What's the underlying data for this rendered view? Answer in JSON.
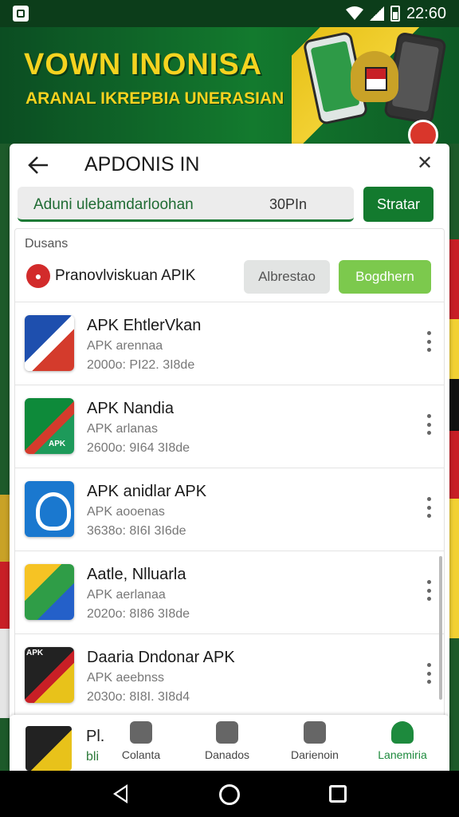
{
  "status_bar": {
    "time": "22:60"
  },
  "banner": {
    "title": "VOWN INONISA",
    "subtitle": "ARANAL IKREPBIA UNERASIAN"
  },
  "header": {
    "title": "APDONIS IN",
    "search_left": "Aduni ulebamdarloohan",
    "search_right": "30PIn",
    "start_label": "Stratar"
  },
  "list": {
    "section_label": "Dusans",
    "featured": {
      "name": "Pranovlviskuan APIK",
      "alt_label": "Albrestao",
      "download_label": "Bogdhern"
    },
    "apps": [
      {
        "name": "APK EhtlerVkan",
        "sub": "APK arennaa",
        "meta": "2000o: PI22. 3I8de",
        "tag": ""
      },
      {
        "name": "APK Nandia",
        "sub": "APK arlanas",
        "meta": "2600o: 9I64 3I8de",
        "tag": "APK"
      },
      {
        "name": "APK anidlar APK",
        "sub": "APK aooenas",
        "meta": "3638o: 8I6I 3I6de",
        "tag": ""
      },
      {
        "name": "Aatle, Nlluarla",
        "sub": "APK aerlanaa",
        "meta": "2020o: 8I86 3I8de",
        "tag": ""
      },
      {
        "name": "Daaria Dndonar APK",
        "sub": "APK aeebnss",
        "meta": "2030o: 8I8I. 3I8d4",
        "tag": "APK"
      }
    ]
  },
  "bottom_nav": {
    "mini_title": "Pl.",
    "mini_sub": "bli",
    "items": [
      {
        "label": "Colanta",
        "icon": "tag-icon"
      },
      {
        "label": "Danados",
        "icon": "lock-icon"
      },
      {
        "label": "Darienoin",
        "icon": "search-icon"
      },
      {
        "label": "Lanemiria",
        "icon": "person-icon"
      }
    ]
  }
}
